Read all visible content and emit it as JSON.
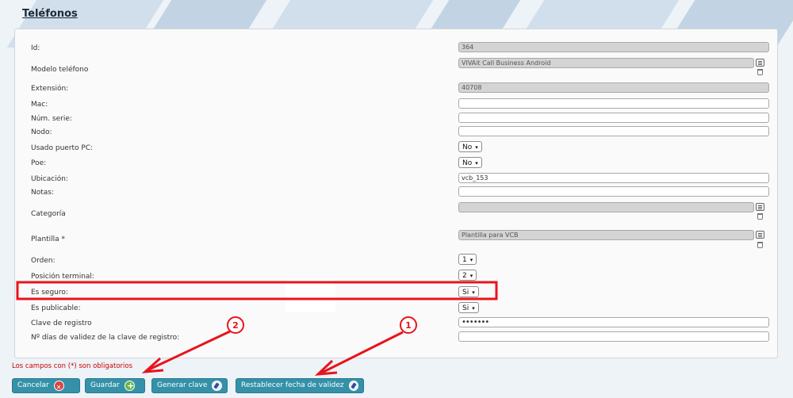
{
  "page": {
    "title": "Teléfonos"
  },
  "form": {
    "id": {
      "label": "Id:",
      "value": "364"
    },
    "modelo": {
      "label": "Modelo teléfono",
      "value": "VIVAit Call Business Android"
    },
    "extension": {
      "label": "Extensión:",
      "value": "40708"
    },
    "mac": {
      "label": "Mac:",
      "value": ""
    },
    "serie": {
      "label": "Núm. serie:",
      "value": ""
    },
    "nodo": {
      "label": "Nodo:",
      "value": ""
    },
    "puerto_pc": {
      "label": "Usado puerto PC:",
      "value": "No"
    },
    "poe": {
      "label": "Poe:",
      "value": "No"
    },
    "ubicacion": {
      "label": "Ubicación:",
      "value": "vcb_153"
    },
    "notas": {
      "label": "Notas:",
      "value": ""
    },
    "categoria": {
      "label": "Categoría",
      "value": ""
    },
    "plantilla": {
      "label": "Plantilla *",
      "value": "Plantilla para VCB"
    },
    "orden": {
      "label": "Orden:",
      "value": "1"
    },
    "posicion": {
      "label": "Posición terminal:",
      "value": "2"
    },
    "seguro": {
      "label": "Es seguro:",
      "value": "Si"
    },
    "publicable": {
      "label": "Es publicable:",
      "value": "Si"
    },
    "clave": {
      "label": "Clave de registro",
      "value": "•••••••"
    },
    "dias": {
      "label": "Nº días de validez de la clave de registro:",
      "value": ""
    }
  },
  "required_note": "Los campos con (*) son obligatorios",
  "buttons": {
    "cancel": "Cancelar",
    "save": "Guardar",
    "generate": "Generar clave",
    "reset": "Restablecer fecha de validez"
  },
  "annotations": {
    "marker1": "1",
    "marker2": "2",
    "color": "#e8141c"
  },
  "colors": {
    "button_bg": "#3591a8",
    "required_text": "#cc0000"
  }
}
